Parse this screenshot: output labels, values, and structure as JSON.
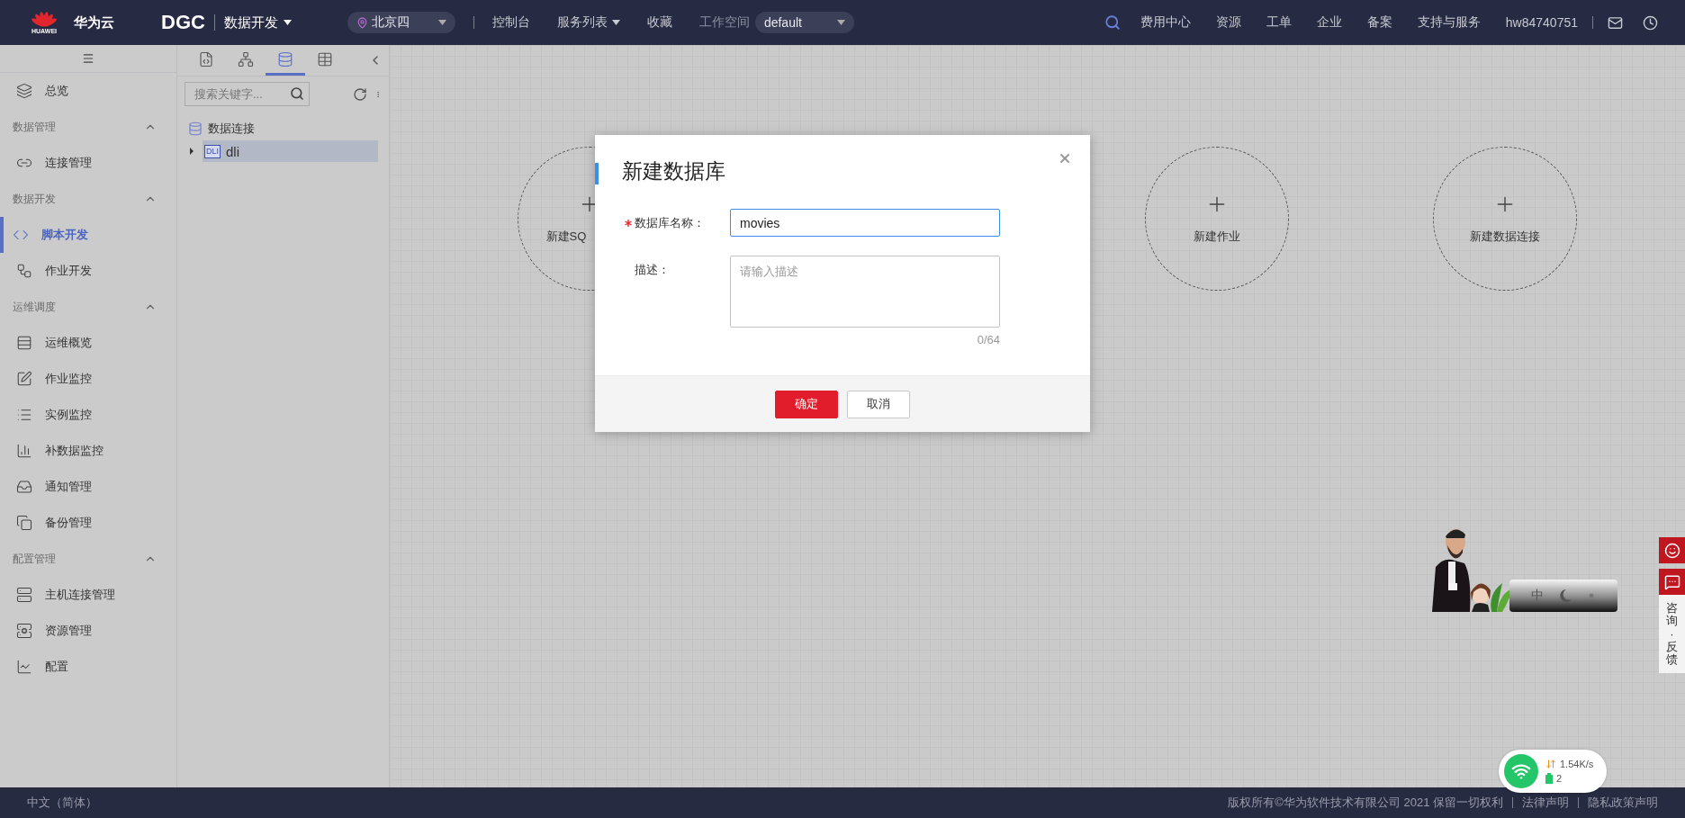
{
  "topbar": {
    "logo_caption": "HUAWEI",
    "brand": "华为云",
    "product": "DGC",
    "module": "数据开发",
    "region": "北京四",
    "nav": [
      {
        "label": "控制台",
        "dropdown": false
      },
      {
        "label": "服务列表",
        "dropdown": true
      },
      {
        "label": "收藏",
        "dropdown": false
      }
    ],
    "workspace_label": "工作空间",
    "workspace": "default",
    "links": [
      "费用中心",
      "资源",
      "工单",
      "企业",
      "备案",
      "支持与服务"
    ],
    "user": "hw84740751"
  },
  "sidebar": {
    "items": [
      {
        "kind": "item",
        "label": "总览",
        "selected": false
      },
      {
        "kind": "section",
        "label": "数据管理",
        "expanded": true,
        "children": [
          {
            "label": "连接管理",
            "selected": false
          }
        ]
      },
      {
        "kind": "section",
        "label": "数据开发",
        "expanded": true,
        "children": [
          {
            "label": "脚本开发",
            "selected": true
          },
          {
            "label": "作业开发",
            "selected": false
          }
        ]
      },
      {
        "kind": "section",
        "label": "运维调度",
        "expanded": true,
        "children": [
          {
            "label": "运维概览",
            "selected": false
          },
          {
            "label": "作业监控",
            "selected": false
          },
          {
            "label": "实例监控",
            "selected": false
          },
          {
            "label": "补数据监控",
            "selected": false
          },
          {
            "label": "通知管理",
            "selected": false
          },
          {
            "label": "备份管理",
            "selected": false
          }
        ]
      },
      {
        "kind": "section",
        "label": "配置管理",
        "expanded": true,
        "children": [
          {
            "label": "主机连接管理",
            "selected": false
          },
          {
            "label": "资源管理",
            "selected": false
          },
          {
            "label": "配置",
            "selected": false
          }
        ]
      }
    ]
  },
  "explorer": {
    "tabs": [
      {
        "selected": false
      },
      {
        "selected": false
      },
      {
        "selected": true
      },
      {
        "selected": false
      }
    ],
    "search": {
      "placeholder": "搜索关键字..."
    },
    "tree": [
      {
        "label": "数据连接",
        "children": [
          {
            "badge": "DLI",
            "label": "dli",
            "selected": true
          }
        ]
      }
    ]
  },
  "canvas": {
    "cards": [
      {
        "label": "新建SQ"
      },
      {
        "label": "新建作业"
      },
      {
        "label": "新建数据连接"
      }
    ]
  },
  "dialog": {
    "title": "新建数据库",
    "fields": [
      {
        "kind": "input",
        "label": "数据库名称：",
        "required": true,
        "value": "movies",
        "focused": true
      },
      {
        "kind": "textarea",
        "label": "描述：",
        "required": false,
        "placeholder": "请输入描述",
        "counter": "0/64",
        "focused": false
      }
    ],
    "buttons": [
      {
        "label": "确定",
        "primary": true
      },
      {
        "label": "取消",
        "primary": false
      }
    ]
  },
  "feedback": {
    "label": "咨询·反馈"
  },
  "ime": {
    "mode": "中"
  },
  "network": {
    "speed": "1.54K/s",
    "count": "2"
  },
  "footer": {
    "language": "中文（简体）",
    "copyright": "版权所有©华为软件技术有限公司 2021 保留一切权利",
    "links": [
      "法律声明",
      "隐私政策声明"
    ]
  }
}
